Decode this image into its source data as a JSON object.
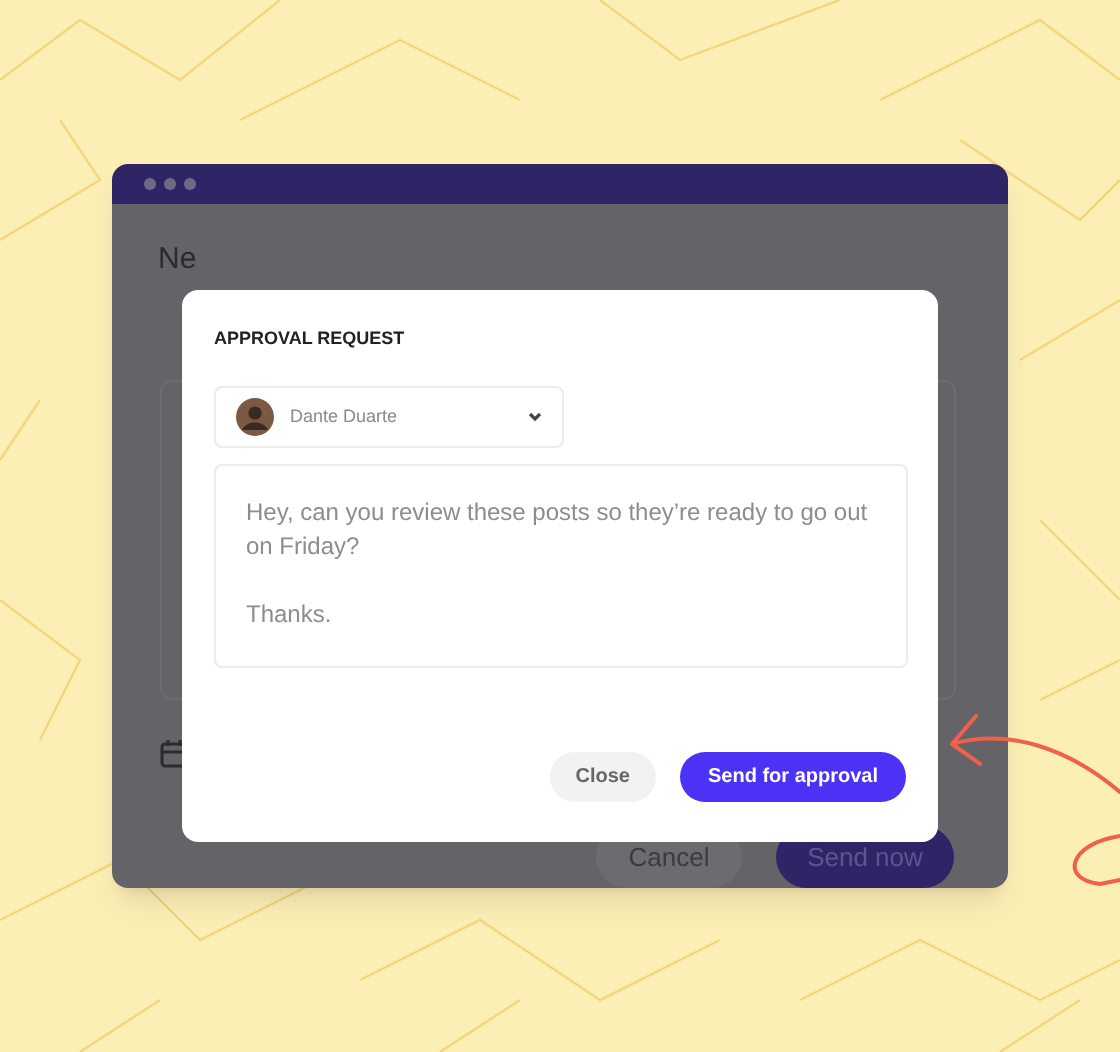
{
  "window": {
    "heading": "Ne",
    "buttons": [
      {
        "label": "Cancel",
        "kind": "secondary"
      },
      {
        "label": "Send now",
        "kind": "primary"
      }
    ]
  },
  "dialog": {
    "title": "APPROVAL REQUEST",
    "recipient": {
      "name": "Dante Duarte"
    },
    "message": [
      "Hey, can you review these posts so they’re ready to go out on Friday?",
      "Thanks."
    ],
    "buttons": [
      {
        "label": "Close",
        "kind": "secondary"
      },
      {
        "label": "Send for approval",
        "kind": "primary"
      }
    ]
  }
}
